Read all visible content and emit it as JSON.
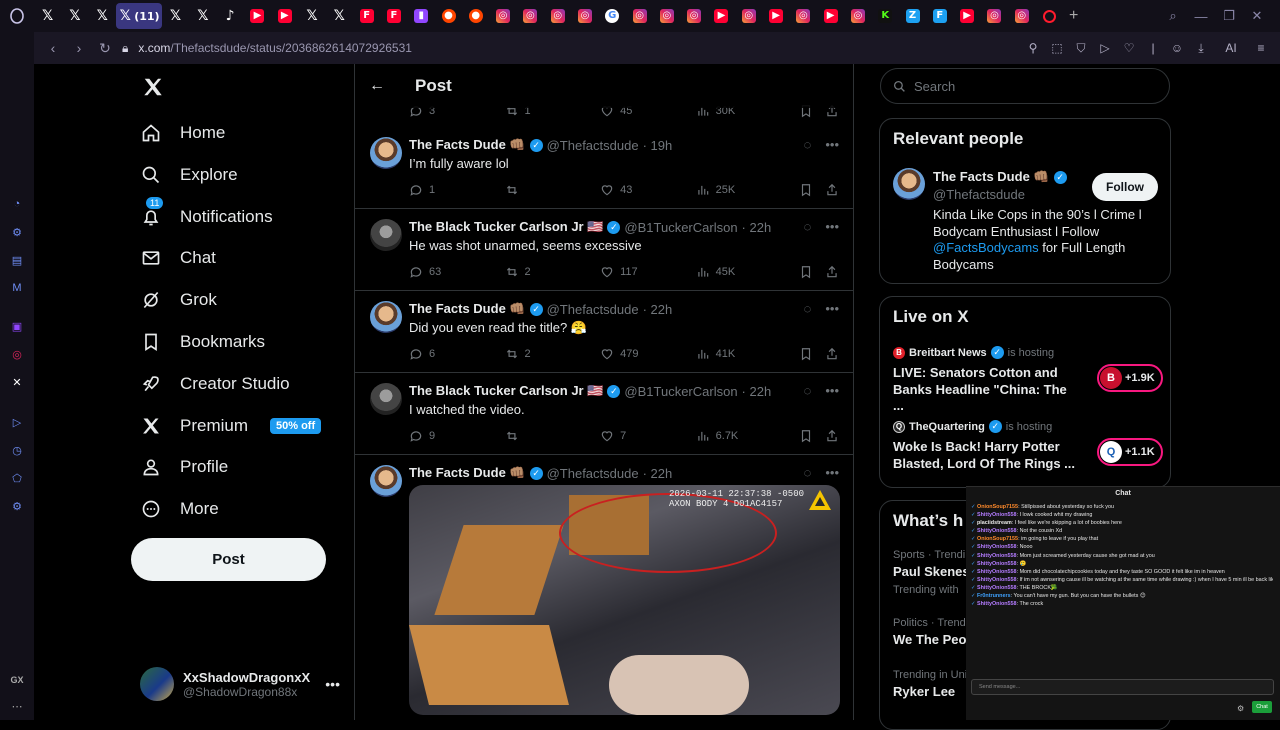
{
  "browser": {
    "active_tab_label": "(11)",
    "tab_icons": [
      "x",
      "x",
      "x",
      "x",
      "x",
      "x",
      "tiktok",
      "youtube",
      "youtube",
      "x",
      "x",
      "flipboard",
      "flipboard",
      "twitch",
      "reddit",
      "reddit",
      "instagram",
      "instagram",
      "instagram",
      "instagram",
      "google",
      "instagram",
      "instagram",
      "instagram",
      "youtube",
      "instagram",
      "youtube",
      "instagram",
      "youtube",
      "instagram",
      "kick",
      "zoom",
      "fox",
      "youtube",
      "instagram",
      "instagram",
      "opera"
    ],
    "url_domain": "x.com",
    "url_path": "/Thefactsdude/status/2036862614072926531",
    "ai_label": "AI",
    "gx_label": "GX"
  },
  "nav": {
    "home": "Home",
    "explore": "Explore",
    "notifications": "Notifications",
    "notifications_badge": "11",
    "chat": "Chat",
    "grok": "Grok",
    "bookmarks": "Bookmarks",
    "creator_studio": "Creator Studio",
    "premium": "Premium",
    "premium_badge": "50% off",
    "profile": "Profile",
    "more": "More",
    "post_button": "Post"
  },
  "account": {
    "display_name": "XxShadowDragonxX",
    "handle": "@ShadowDragon88x"
  },
  "header": {
    "title": "Post"
  },
  "top_actions": {
    "replies": "3",
    "reposts": "1",
    "likes": "45",
    "views": "30K"
  },
  "tweets": [
    {
      "name": "The Facts Dude 👊🏽",
      "handle": "@Thefactsdude",
      "time": "· 19h",
      "text": "I’m fully aware lol",
      "replies": "1",
      "reposts": "",
      "likes": "43",
      "views": "25K"
    },
    {
      "name": "The Black Tucker Carlson Jr 🇺🇸",
      "handle": "@B1TuckerCarlson",
      "time": "· 22h",
      "text": "He was shot unarmed, seems excessive",
      "replies": "63",
      "reposts": "2",
      "likes": "117",
      "views": "45K"
    },
    {
      "name": "The Facts Dude 👊🏽",
      "handle": "@Thefactsdude",
      "time": "· 22h",
      "text": "Did you even read the title? 😤",
      "replies": "6",
      "reposts": "2",
      "likes": "479",
      "views": "41K"
    },
    {
      "name": "The Black Tucker Carlson Jr 🇺🇸",
      "handle": "@B1TuckerCarlson",
      "time": "· 22h",
      "text": "I watched the video.",
      "replies": "9",
      "reposts": "",
      "likes": "7",
      "views": "6.7K"
    },
    {
      "name": "The Facts Dude 👊🏽",
      "handle": "@Thefactsdude",
      "time": "· 22h",
      "media_timestamp": "2026-03-11 22:37:38 -0500",
      "media_device": "AXON BODY 4 D01AC4157"
    }
  ],
  "search": {
    "placeholder": "Search"
  },
  "relevant": {
    "heading": "Relevant people",
    "name": "The Facts Dude 👊🏽",
    "handle": "@Thefactsdude",
    "follow": "Follow",
    "bio_before": "Kinda Like Cops in the 90’s l Crime l Bodycam Enthusiast l Follow ",
    "bio_link": "@FactsBodycams",
    "bio_after": " for Full Length Bodycams"
  },
  "live": {
    "heading": "Live on X",
    "items": [
      {
        "host": "Breitbart News",
        "label": "is hosting",
        "title": "LIVE: Senators Cotton and Banks Headline \"China: The ...",
        "count": "+1.9K"
      },
      {
        "host": "TheQuartering",
        "label": "is hosting",
        "title": "Woke Is Back! Harry Potter Blasted, Lord Of The Rings ...",
        "count": "+1.1K"
      }
    ]
  },
  "whats": {
    "heading": "What’s h",
    "trends": [
      {
        "context": "Sports · Trendi",
        "topic": "Paul Skenes",
        "sub": "Trending with"
      },
      {
        "context": "Politics · Trend",
        "topic": "We The Peop"
      },
      {
        "context": "Trending in Uni",
        "topic": "Ryker Lee"
      }
    ]
  },
  "chat": {
    "title": "Chat",
    "input_placeholder": "Send message...",
    "send": "Chat",
    "messages": [
      {
        "user": "OnionSoup7155",
        "color": "#ff8a2b",
        "text": "Stillpissed about yesterday so fuck you"
      },
      {
        "user": "ShittyOnion558",
        "color": "#b47cff",
        "text": "I lowk cooked whit my drawing"
      },
      {
        "user": "placiidstream",
        "color": "#e8e8e8",
        "text": "I feel like we're skipping a lot of boobies here"
      },
      {
        "user": "ShittyOnion558",
        "color": "#b47cff",
        "text": "Not the cousin Xd"
      },
      {
        "user": "OnionSoup7155",
        "color": "#ff8a2b",
        "text": "im going to leave if you play that"
      },
      {
        "user": "ShittyOnion558",
        "color": "#b47cff",
        "text": "Nooo"
      },
      {
        "user": "ShittyOnion558",
        "color": "#b47cff",
        "text": "Mom just screamed yesterday cause she got mad at you"
      },
      {
        "user": "ShittyOnion558",
        "color": "#b47cff",
        "text": "🥲"
      },
      {
        "user": "ShittyOnion558",
        "color": "#b47cff",
        "text": "Mom did chocolatechipcookies today and they taste SO GOOD it felt like im in heaven"
      },
      {
        "user": "ShittyOnion558",
        "color": "#b47cff",
        "text": "If im not awnsering cause ill be watching at the same time while drawing :) when I have 5 min ill be back like yk what i mean.. (ill be waiting for the stick stick👋)"
      },
      {
        "user": "ShittyOnion558",
        "color": "#b47cff",
        "text": "THE BROCK🥦"
      },
      {
        "user": "Fr0ntrunners",
        "color": "#3fa2ff",
        "text": "You can't have my gun. But you can have the bullets 😊"
      },
      {
        "user": "ShittyOnion558",
        "color": "#b47cff",
        "text": "The crock"
      }
    ]
  }
}
